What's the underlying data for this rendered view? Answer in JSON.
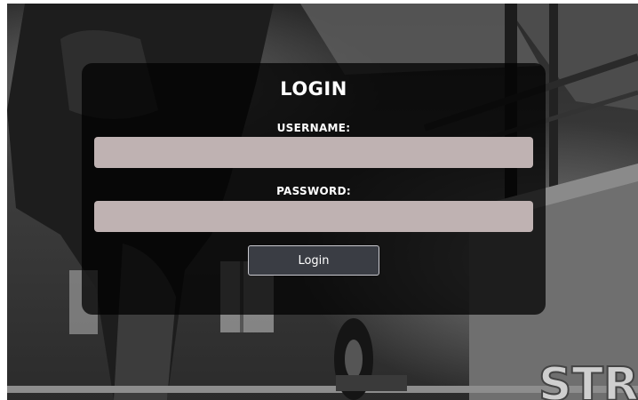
{
  "login": {
    "title": "LOGIN",
    "username_label": "USERNAME:",
    "username_value": "",
    "password_label": "PASSWORD:",
    "password_value": "",
    "submit_label": "Login"
  },
  "background": {
    "signage_text": "STR"
  },
  "colors": {
    "panel": "#000000",
    "field": "#bfb2b2",
    "button": "#3a3d44",
    "text": "#ffffff"
  }
}
